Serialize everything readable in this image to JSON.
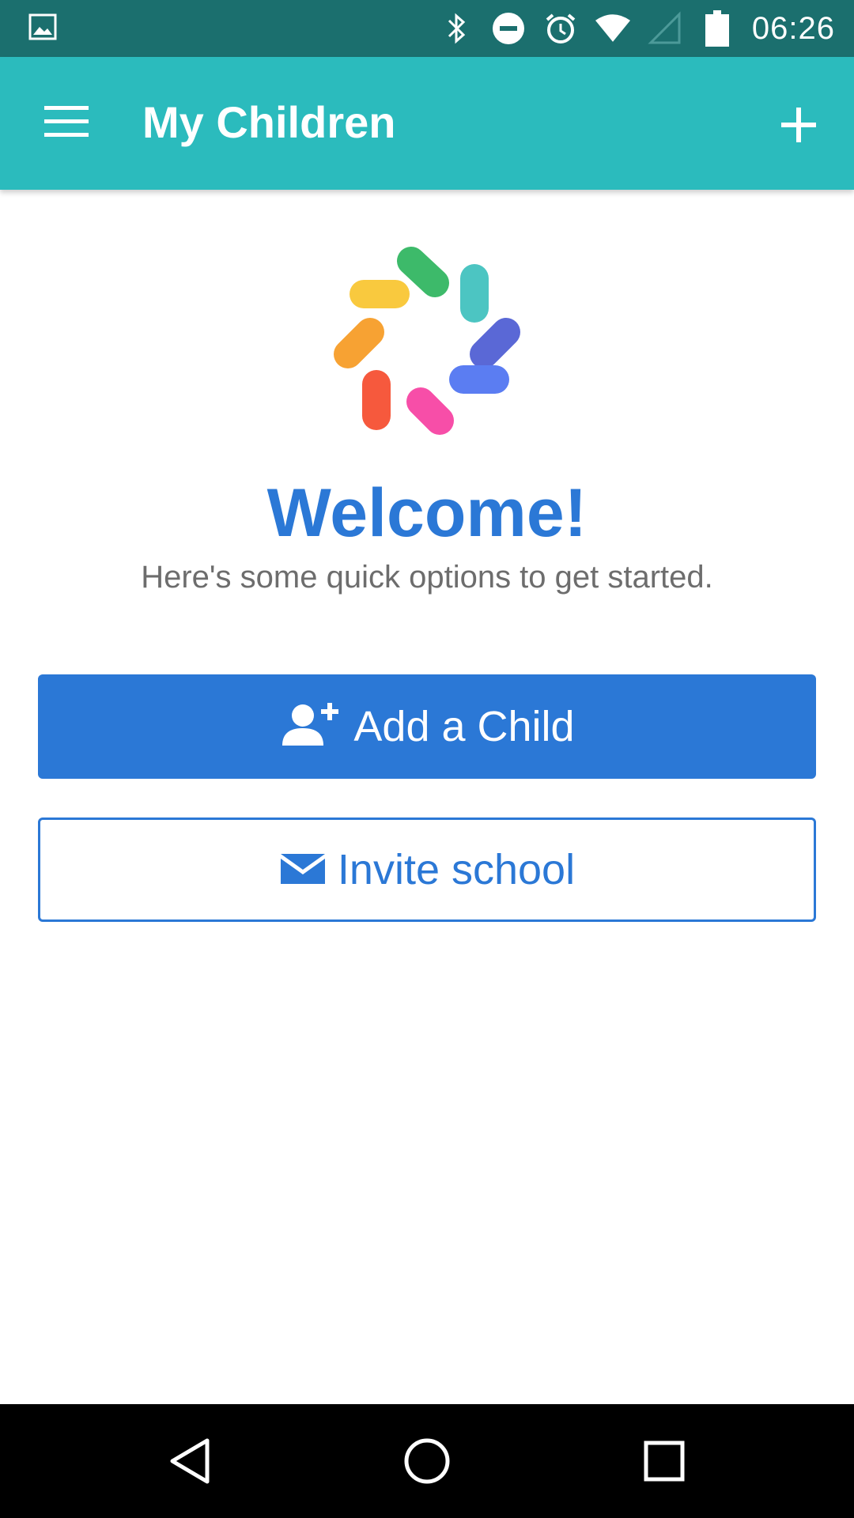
{
  "status_bar": {
    "time": "06:26",
    "icons": [
      "image-icon",
      "bluetooth-icon",
      "do-not-disturb-icon",
      "alarm-icon",
      "wifi-icon",
      "cell-signal-icon",
      "battery-icon"
    ]
  },
  "app_bar": {
    "title": "My Children",
    "menu_icon": "hamburger-menu-icon",
    "add_icon": "plus-icon",
    "background_color": "#2bbbbd"
  },
  "main": {
    "logo_icon": "colorful-pinwheel-logo",
    "welcome": "Welcome!",
    "subtitle": "Here's some quick options to get started.",
    "add_child_button": {
      "label": "Add a Child",
      "icon": "add-user-icon"
    },
    "invite_school_button": {
      "label": "Invite school",
      "icon": "envelope-icon"
    },
    "accent_color": "#2b78d6"
  },
  "nav_bar": {
    "icons": [
      "back-icon",
      "home-icon",
      "recents-icon"
    ]
  }
}
